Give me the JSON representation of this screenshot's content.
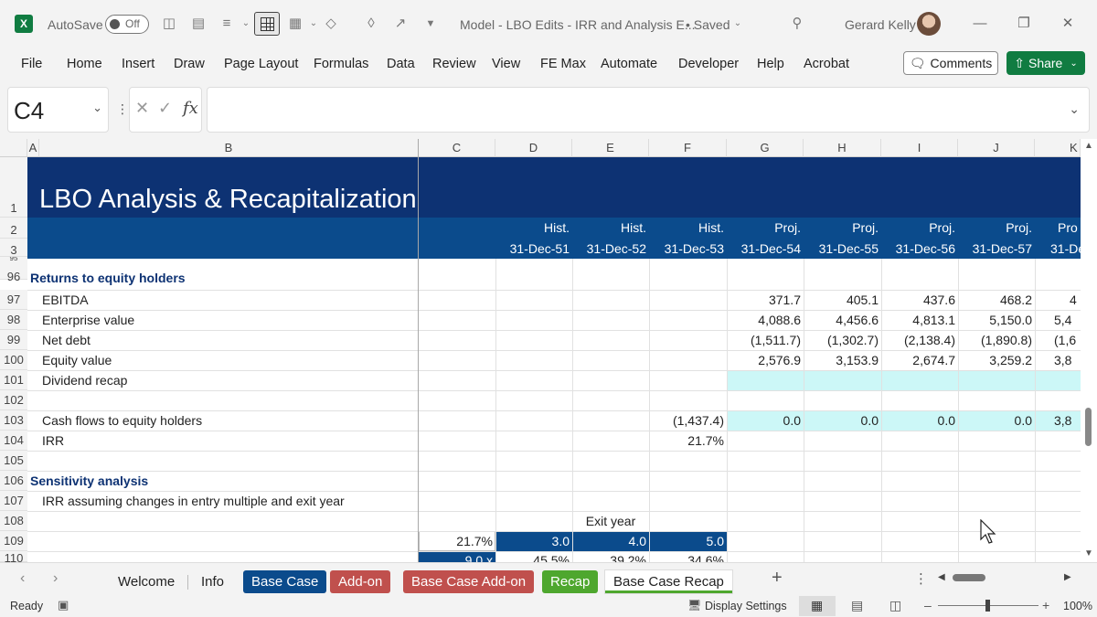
{
  "titlebar": {
    "app_icon": "X",
    "autosave_label": "AutoSave",
    "autosave_state": "Off",
    "doc_title": "Model - LBO Edits - IRR and Analysis E...",
    "saved_status": "• Saved",
    "user_name": "Gerard Kelly"
  },
  "menu": [
    "File",
    "Home",
    "Insert",
    "Draw",
    "Page Layout",
    "Formulas",
    "Data",
    "Review",
    "View",
    "FE Max",
    "Automate",
    "Developer",
    "Help",
    "Acrobat"
  ],
  "buttons": {
    "comments": "Comments",
    "share": "Share"
  },
  "formula_bar": {
    "name_box": "C4",
    "fx": "fx",
    "formula": ""
  },
  "columns": [
    "A",
    "B",
    "C",
    "D",
    "E",
    "F",
    "G",
    "H",
    "I",
    "J",
    "K"
  ],
  "sheet": {
    "title": "LBO Analysis & Recapitalization",
    "period_types": [
      "Hist.",
      "Hist.",
      "Hist.",
      "Proj.",
      "Proj.",
      "Proj.",
      "Proj.",
      "Pro"
    ],
    "period_dates": [
      "31-Dec-51",
      "31-Dec-52",
      "31-Dec-53",
      "31-Dec-54",
      "31-Dec-55",
      "31-Dec-56",
      "31-Dec-57",
      "31-De"
    ],
    "row_numbers": [
      "1",
      "2",
      "3",
      "95",
      "96",
      "97",
      "98",
      "99",
      "100",
      "101",
      "102",
      "103",
      "104",
      "105",
      "106",
      "107",
      "108",
      "109",
      "110"
    ],
    "rows": {
      "r96": {
        "label": "Returns to equity holders"
      },
      "r97": {
        "label": "EBITDA",
        "values": [
          "371.7",
          "405.1",
          "437.6",
          "468.2",
          "4"
        ]
      },
      "r98": {
        "label": "Enterprise value",
        "values": [
          "4,088.6",
          "4,456.6",
          "4,813.1",
          "5,150.0",
          "5,4"
        ]
      },
      "r99": {
        "label": "Net debt",
        "values": [
          "(1,511.7)",
          "(1,302.7)",
          "(2,138.4)",
          "(1,890.8)",
          "(1,6"
        ]
      },
      "r100": {
        "label": "Equity value",
        "values": [
          "2,576.9",
          "3,153.9",
          "2,674.7",
          "3,259.2",
          "3,8"
        ]
      },
      "r101": {
        "label": "Dividend recap"
      },
      "r103": {
        "label": "Cash flows to equity holders",
        "f": "(1,437.4)",
        "values": [
          "0.0",
          "0.0",
          "0.0",
          "0.0",
          "3,8"
        ]
      },
      "r104": {
        "label": "IRR",
        "f": "21.7%"
      },
      "r106": {
        "label": "Sensitivity analysis"
      },
      "r107": {
        "label": "IRR assuming changes in entry multiple and exit year"
      },
      "r108": {
        "exit_label": "Exit year"
      },
      "r109": {
        "corner": "21.7%",
        "years": [
          "3.0",
          "4.0",
          "5.0"
        ]
      },
      "r110": {
        "multiple": "9.0 x",
        "values": [
          "45.5%",
          "39.2%",
          "34.6%"
        ]
      }
    }
  },
  "tabs": [
    {
      "label": "Welcome",
      "bg": "",
      "fg": "#222"
    },
    {
      "label": "Info",
      "bg": "",
      "fg": "#222"
    },
    {
      "label": "Base Case",
      "bg": "#0b4b8c",
      "fg": "#fff"
    },
    {
      "label": "Add-on",
      "bg": "#c0504d",
      "fg": "#fff"
    },
    {
      "label": "Base Case Add-on",
      "bg": "#c0504d",
      "fg": "#fff"
    },
    {
      "label": "Recap",
      "bg": "#4ea72e",
      "fg": "#fff"
    },
    {
      "label": "Base Case Recap",
      "bg": "#fff",
      "fg": "#222"
    }
  ],
  "status": {
    "ready": "Ready",
    "display_settings": "Display Settings",
    "zoom": "100%"
  },
  "colors": {
    "title_bg": "#0d3273",
    "header_bg": "#0b4b8c",
    "input_bg": "#ccf7f7",
    "excel_green": "#107c41"
  }
}
